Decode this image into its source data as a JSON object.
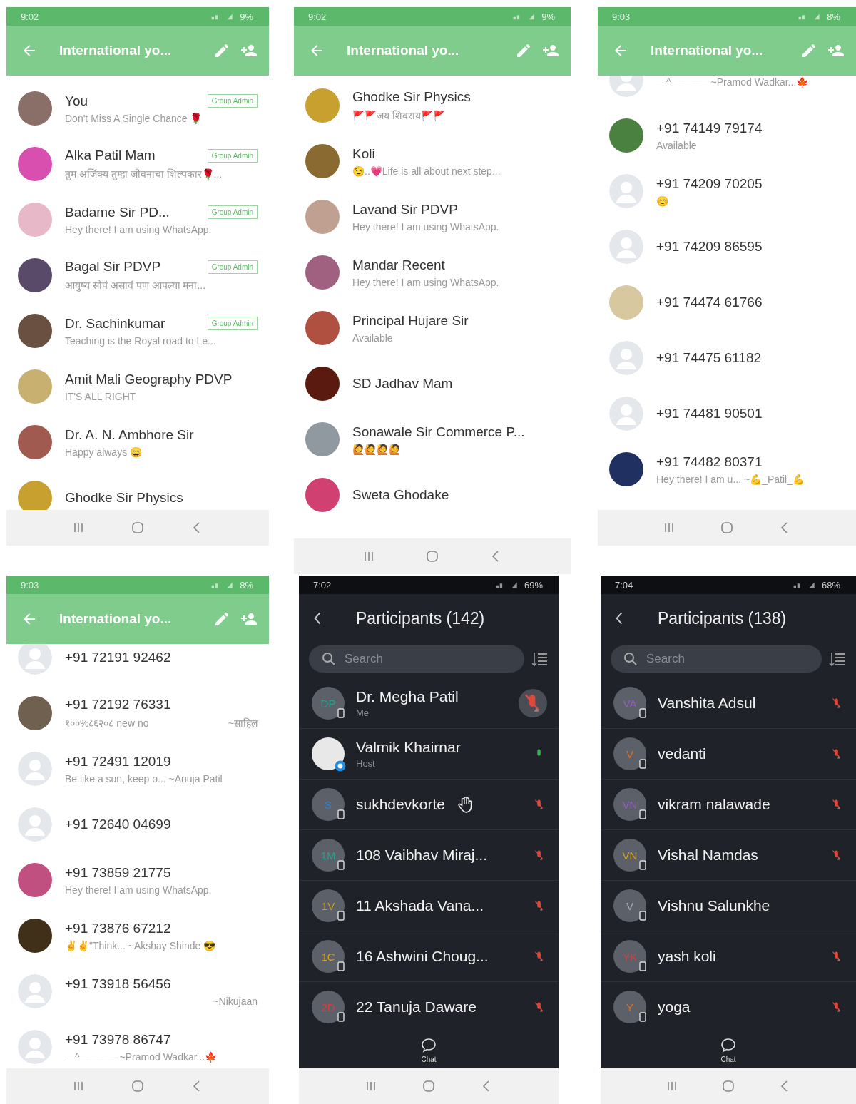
{
  "screens": [
    {
      "kind": "whatsapp",
      "status_bar": {
        "time": "9:02",
        "battery": "9%"
      },
      "header": {
        "title": "International yo..."
      },
      "members": [
        {
          "name": "You",
          "about": "Don't Miss A Single Chance 🌹",
          "badge": "Group Admin",
          "color": "#8a6f68"
        },
        {
          "name": "Alka Patil Mam",
          "about": "तुम अजिंक्य तुम्हा जीवनाचा शिल्पकार🌹...",
          "badge": "Group Admin",
          "color": "#d94fb0"
        },
        {
          "name": "Badame Sir PD...",
          "about": "Hey there! I am using WhatsApp.",
          "badge": "Group Admin",
          "color": "#e6b8c8"
        },
        {
          "name": "Bagal Sir PDVP",
          "about": "आयुष्य सोपं असावं पण आपल्या मना...",
          "badge": "Group Admin",
          "color": "#5a4a6a"
        },
        {
          "name": "Dr. Sachinkumar",
          "about": "Teaching is the Royal road to Le...",
          "badge": "Group Admin",
          "color": "#6a5040"
        },
        {
          "name": "Amit Mali Geography PDVP",
          "about": "IT'S ALL RIGHT",
          "color": "#c8b070"
        },
        {
          "name": "Dr. A. N. Ambhore Sir",
          "about": "Happy always 😄",
          "color": "#a05a50"
        },
        {
          "name": "Ghodke Sir Physics",
          "color": "#c8a030"
        }
      ]
    },
    {
      "kind": "whatsapp",
      "status_bar": {
        "time": "9:02",
        "battery": "9%"
      },
      "header": {
        "title": "International yo..."
      },
      "members": [
        {
          "name": "Ghodke Sir Physics",
          "about": "🚩🚩जय शिवराय🚩🚩",
          "color": "#c8a030"
        },
        {
          "name": "Koli",
          "about": "😉..💗Life is all about next step...",
          "color": "#8a6a30"
        },
        {
          "name": "Lavand Sir PDVP",
          "about": "Hey there! I am using WhatsApp.",
          "color": "#c0a090"
        },
        {
          "name": "Mandar Recent",
          "about": "Hey there! I am using WhatsApp.",
          "color": "#a06080"
        },
        {
          "name": "Principal Hujare Sir",
          "about": "Available",
          "color": "#b05040"
        },
        {
          "name": "SD Jadhav Mam",
          "color": "#5a1a10"
        },
        {
          "name": "Sonawale Sir Commerce P...",
          "about": "🙋🙋🙋🙋",
          "color": "#9098a0"
        },
        {
          "name": "Sweta Ghodake",
          "color": "#d04070"
        }
      ]
    },
    {
      "kind": "whatsapp",
      "status_bar": {
        "time": "9:03",
        "battery": "8%"
      },
      "header": {
        "title": "International yo..."
      },
      "members": [
        {
          "about": "—^————~Pramod Wadkar...🍁"
        },
        {
          "name": "+91 74149 79174",
          "about": "Available",
          "color": "#4a8040"
        },
        {
          "name": "+91 74209 70205",
          "about": "😊"
        },
        {
          "name": "+91 74209 86595"
        },
        {
          "name": "+91 74474 61766",
          "color": "#d8c8a0"
        },
        {
          "name": "+91 74475 61182"
        },
        {
          "name": "+91 74481 90501"
        },
        {
          "name": "+91 74482 80371",
          "about": "Hey there! I am u... ~💪_Patil_💪",
          "color": "#203060"
        }
      ]
    },
    {
      "kind": "whatsapp",
      "status_bar": {
        "time": "9:03",
        "battery": "8%"
      },
      "header": {
        "title": "International yo..."
      },
      "members": [
        {
          "name": "+91 72191 92462"
        },
        {
          "name": "+91 72192 76331",
          "about": "१००%८६२०८ new no",
          "about_right": "~साहिल",
          "color": "#706050"
        },
        {
          "name": "+91 72491 12019",
          "about": "Be like a sun, keep o... ~Anuja Patil"
        },
        {
          "name": "+91 72640 04699"
        },
        {
          "name": "+91 73859 21775",
          "about": "Hey there! I am using WhatsApp.",
          "color": "#c05080"
        },
        {
          "name": "+91 73876 67212",
          "about": "✌✌\"Think...   ~Akshay Shinde 😎",
          "color": "#40301a"
        },
        {
          "name": "+91 73918 56456",
          "about_right": "~Nikujaan"
        },
        {
          "name": "+91 73978 86747",
          "about": "—^————~Pramod Wadkar...🍁"
        }
      ]
    },
    {
      "kind": "zoom",
      "status_bar": {
        "time": "7:02",
        "battery": "69%"
      },
      "header": {
        "title": "Participants (142)"
      },
      "search": {
        "placeholder": "Search"
      },
      "footer": {
        "label": "Chat"
      },
      "participants": [
        {
          "kind": "self",
          "name": "Dr. Megha Patil",
          "role": "Me",
          "initials": "DP",
          "color": "#2aa090",
          "muted": true,
          "hand_raised": false
        },
        {
          "kind": "host",
          "name": "Valmik Khairnar",
          "role": "Host",
          "muted": false,
          "hand_raised": false
        },
        {
          "kind": "member",
          "name": "sukhdevkorte",
          "initials": "S",
          "color": "#3080d0",
          "muted": true,
          "hand_raised": true
        },
        {
          "kind": "member",
          "name": "108 Vaibhav Miraj...",
          "initials": "1M",
          "color": "#2aa090",
          "muted": true,
          "hand_raised": false
        },
        {
          "kind": "member",
          "name": "11 Akshada Vana...",
          "initials": "1V",
          "color": "#d0a020",
          "muted": true,
          "hand_raised": false
        },
        {
          "kind": "member",
          "name": "16 Ashwini Choug...",
          "initials": "1C",
          "color": "#d0a020",
          "muted": true,
          "hand_raised": false
        },
        {
          "kind": "member",
          "name": "22 Tanuja Daware",
          "initials": "2D",
          "color": "#d04040",
          "muted": true,
          "hand_raised": false
        }
      ]
    },
    {
      "kind": "zoom",
      "status_bar": {
        "time": "7:04",
        "battery": "68%"
      },
      "header": {
        "title": "Participants (138)"
      },
      "search": {
        "placeholder": "Search"
      },
      "footer": {
        "label": "Chat"
      },
      "participants": [
        {
          "kind": "member",
          "name": "Vanshita Adsul",
          "initials": "VA",
          "color": "#9060c0",
          "muted": true,
          "hand_raised": false
        },
        {
          "kind": "member",
          "name": "vedanti",
          "initials": "V",
          "color": "#e07020",
          "muted": true,
          "hand_raised": false
        },
        {
          "kind": "member",
          "name": "vikram nalawade",
          "initials": "VN",
          "color": "#9060c0",
          "muted": true,
          "hand_raised": false
        },
        {
          "kind": "member",
          "name": "Vishal Namdas",
          "initials": "VN",
          "color": "#d0a020",
          "muted": true,
          "hand_raised": false
        },
        {
          "kind": "member",
          "name": "Vishnu Salunkhe",
          "initials": "V",
          "color": "#a8adb5",
          "hand_raised": false
        },
        {
          "kind": "member",
          "name": "yash koli",
          "initials": "YK",
          "color": "#d04040",
          "muted": true,
          "hand_raised": false
        },
        {
          "kind": "member",
          "name": "yoga",
          "initials": "Y",
          "color": "#e07020",
          "muted": true,
          "hand_raised": false
        }
      ]
    }
  ]
}
